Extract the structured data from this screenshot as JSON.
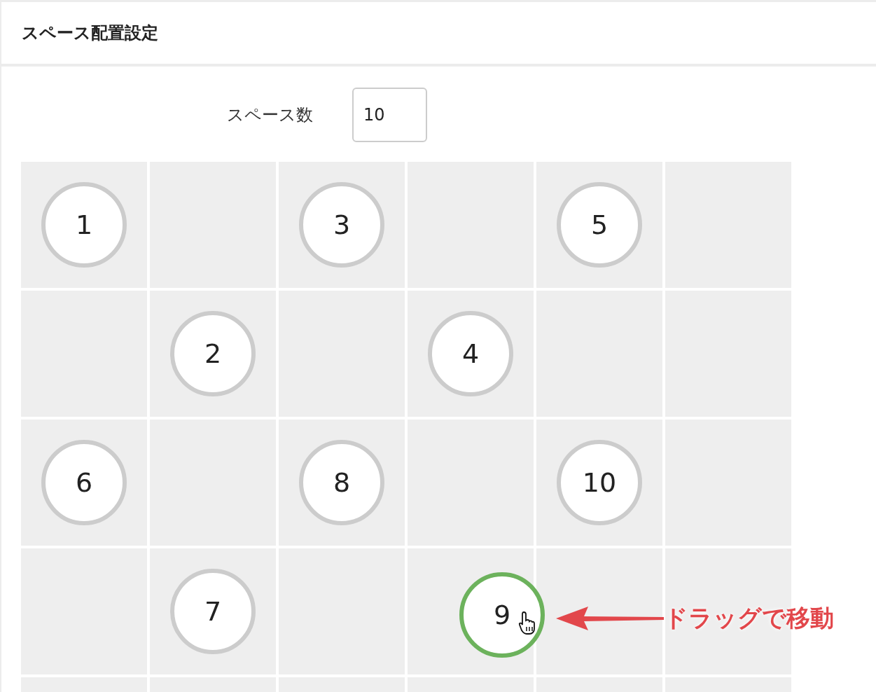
{
  "panel": {
    "title": "スペース配置設定"
  },
  "space_count": {
    "label": "スペース数",
    "value": "10"
  },
  "grid": {
    "rows": [
      {
        "cells": [
          {
            "kind": "space",
            "marker": {
              "label": "1",
              "dragging": false
            }
          },
          {
            "kind": "empty"
          },
          {
            "kind": "space",
            "marker": {
              "label": "3",
              "dragging": false
            }
          },
          {
            "kind": "empty"
          },
          {
            "kind": "space",
            "marker": {
              "label": "5",
              "dragging": false
            }
          },
          {
            "kind": "empty"
          }
        ]
      },
      {
        "cells": [
          {
            "kind": "empty"
          },
          {
            "kind": "space",
            "marker": {
              "label": "2",
              "dragging": false
            }
          },
          {
            "kind": "empty"
          },
          {
            "kind": "space",
            "marker": {
              "label": "4",
              "dragging": false
            }
          },
          {
            "kind": "empty"
          },
          {
            "kind": "empty"
          }
        ]
      },
      {
        "cells": [
          {
            "kind": "space",
            "marker": {
              "label": "6",
              "dragging": false
            }
          },
          {
            "kind": "empty"
          },
          {
            "kind": "space",
            "marker": {
              "label": "8",
              "dragging": false
            }
          },
          {
            "kind": "empty"
          },
          {
            "kind": "space",
            "marker": {
              "label": "10",
              "dragging": false
            }
          },
          {
            "kind": "empty"
          }
        ]
      },
      {
        "cells": [
          {
            "kind": "empty"
          },
          {
            "kind": "space",
            "marker": {
              "label": "7",
              "dragging": false
            }
          },
          {
            "kind": "empty"
          },
          {
            "kind": "space",
            "marker": {
              "label": "9",
              "dragging": true
            }
          },
          {
            "kind": "empty"
          },
          {
            "kind": "empty"
          }
        ]
      },
      {
        "cells": [
          {
            "kind": "empty"
          },
          {
            "kind": "empty"
          },
          {
            "kind": "empty"
          },
          {
            "kind": "empty"
          },
          {
            "kind": "empty"
          },
          {
            "kind": "empty"
          }
        ]
      }
    ]
  },
  "annotation": {
    "text": "ドラッグで移動"
  }
}
